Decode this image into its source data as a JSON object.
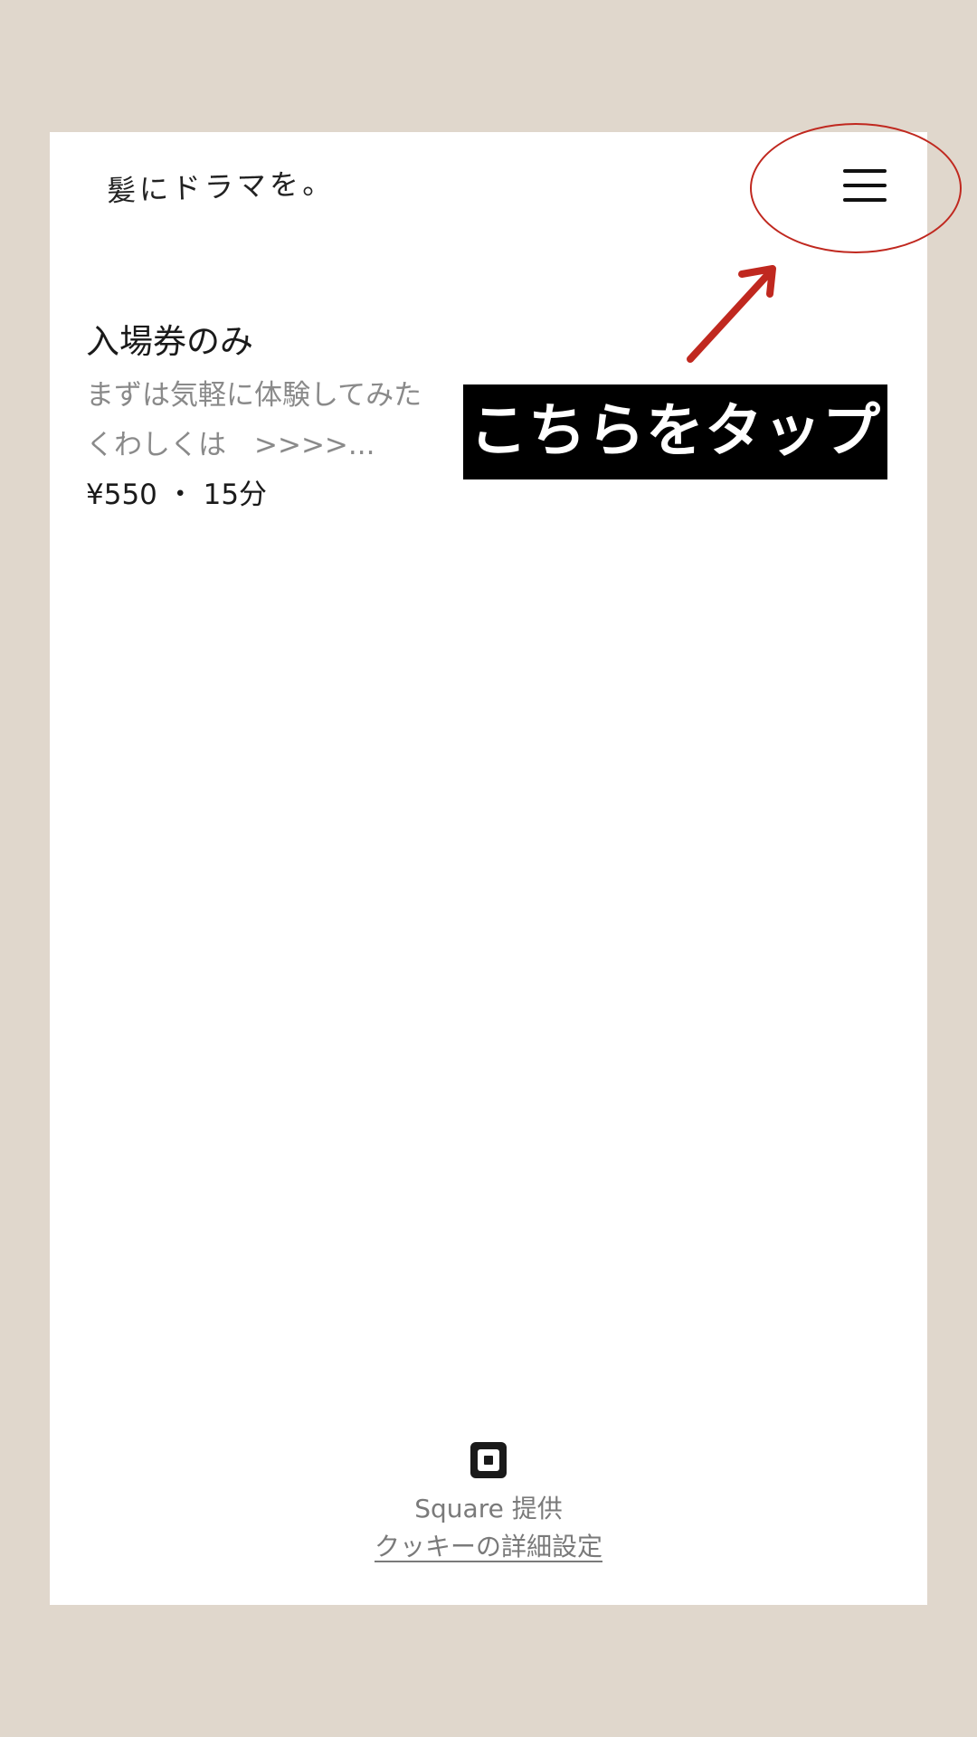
{
  "header": {
    "logo_text": "髪にドラマを。",
    "menu_icon": "hamburger-menu-icon"
  },
  "annotation": {
    "label": "こちらをタップ",
    "highlight_color": "#c0281f",
    "box_color": "#000000"
  },
  "service": {
    "title": "入場券のみ",
    "description_line1": "まずは気軽に体験してみた",
    "description_line2": "くわしくは　>>>>...",
    "meta": "¥550 ・ 15分"
  },
  "footer": {
    "logo_icon": "square-logo-icon",
    "powered_by": "Square 提供",
    "cookie_link": "クッキーの詳細設定"
  },
  "colors": {
    "page_background": "#e0d7cc",
    "card_background": "#ffffff"
  }
}
